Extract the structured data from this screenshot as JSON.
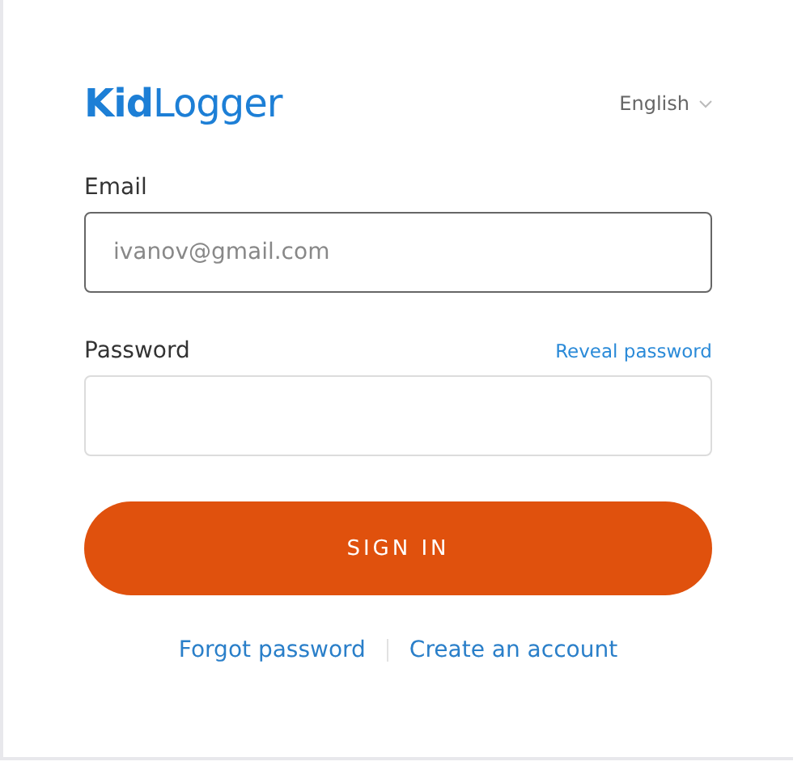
{
  "logo": "**Kid**Logger",
  "language": {
    "label": "English"
  },
  "fields": [
    {
      "label": "Email",
      "placeholder": "ivanov@gmail.com",
      "focused": true
    },
    {
      "label": "Password",
      "action": "Reveal password",
      "focused": false
    }
  ],
  "button": "SIGN IN",
  "links": [
    "Forgot password",
    "Create an account"
  ]
}
